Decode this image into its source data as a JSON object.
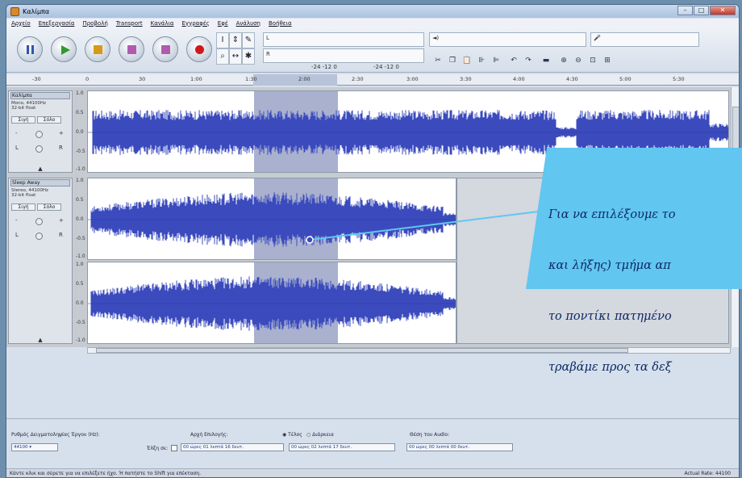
{
  "window": {
    "title": "Καλίμπα"
  },
  "menu": [
    "Αρχείο",
    "Επεξεργασία",
    "Προβολή",
    "Transport",
    "Κανάλια",
    "Εγγραφές",
    "Εφέ",
    "Ανάλυση",
    "Βοήθεια"
  ],
  "toolbar": {
    "meter_left_label": "L",
    "meter_right_label": "R",
    "meter_ticks_a": "-24  -12   0",
    "meter_ticks_b": "-24  -12   0",
    "volume_label": "◄)",
    "mic_label": "🎤"
  },
  "ruler": {
    "ticks": [
      "-30",
      "0",
      "30",
      "1:00",
      "1:30",
      "2:00",
      "2:30",
      "3:00",
      "3:30",
      "4:00",
      "4:30",
      "5:00",
      "5:30"
    ]
  },
  "tracks": [
    {
      "name": "Καλίμπα",
      "info_line1": "Mono, 44100Hz",
      "info_line2": "32-bit float",
      "mute_label": "Σιγή",
      "solo_label": "Σόλο",
      "scale_top": "1.0",
      "scale_upper": "0.5",
      "scale_mid": "0.0",
      "scale_lower": "-0.5",
      "scale_bottom": "-1.0"
    },
    {
      "name": "Sleep Away",
      "info_line1": "Stereo, 44100Hz",
      "info_line2": "32-bit float",
      "mute_label": "Σιγή",
      "solo_label": "Σόλο",
      "scale_top": "1.0",
      "scale_upper": "0.5",
      "scale_mid": "0.0",
      "scale_lower": "-0.5",
      "scale_bottom": "-1.0"
    }
  ],
  "callout": {
    "line1": "Για να επιλέξουμε το",
    "line2": "και λήξης) τμήμα απ",
    "line3": "το ποντίκι πατημένο",
    "line4": "τραβάμε προς τα δεξ",
    "fill_color": "#61c6f0",
    "text_color": "#0e2a62"
  },
  "selection_bar": {
    "rate_label": "Ρυθμός Δειγματοληψίας Έργου (Hz):",
    "rate_value": "44100",
    "snap_label": "Έλξη σε:",
    "start_label": "Αρχή Επιλογής:",
    "end_label": "Τέλος",
    "length_label": "Διάρκεια",
    "audio_position_label": "Θέση του Audio:",
    "start_value": "00 ώρες 01 λεπτά 16 δευτ.",
    "end_value": "00 ώρες 02 λεπτά 17 δευτ.",
    "audio_value": "00 ώρες 00 λεπτά 00 δευτ."
  },
  "status": {
    "left": "Κάντε κλικ και σύρετε για να επιλέξετε ήχο. Ή πατήστε το Shift για επέκταση.",
    "right": "Actual Rate: 44100"
  },
  "colors": {
    "wave": "#3b4bbd",
    "selection": "#a9b1cf",
    "accent": "#61c6f0"
  },
  "icons": {
    "pause": "pause-icon",
    "play": "play-icon",
    "stop": "stop-icon",
    "skip_start": "skip-start-icon",
    "skip_end": "skip-end-icon",
    "record": "record-icon"
  }
}
